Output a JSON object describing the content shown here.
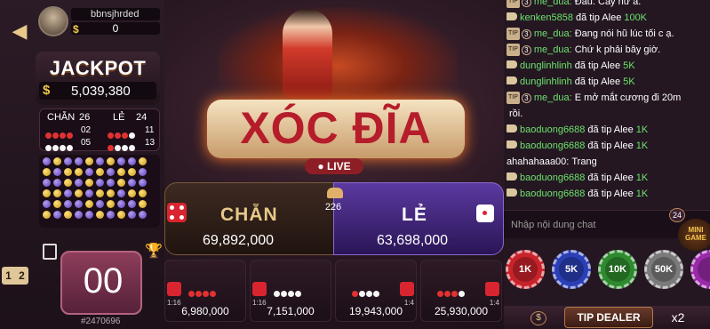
{
  "header": {
    "username": "bbnsjhrded",
    "balance": "0"
  },
  "jackpot": {
    "title": "JACKPOT",
    "currency": "$",
    "value": "5,039,380"
  },
  "stats": {
    "chan_label": "CHẴN",
    "chan_count": "26",
    "le_label": "LẺ",
    "le_count": "24",
    "row1_chan": "02",
    "row1_le": "11",
    "row2_chan": "05",
    "row2_le": "13"
  },
  "pager": {
    "p1": "1",
    "p2": "2"
  },
  "timer": {
    "value": "00",
    "session": "#2470696"
  },
  "game": {
    "logo": "XÓC ĐĨA",
    "live": "● LIVE",
    "players": "226"
  },
  "bets": {
    "chan_label": "CHẴN",
    "chan_amount": "69,892,000",
    "le_label": "LẺ",
    "le_amount": "63,698,000",
    "small": [
      {
        "amount": "6,980,000",
        "ratio": "1:16"
      },
      {
        "amount": "7,151,000",
        "ratio": "1:16"
      },
      {
        "amount": "19,943,000",
        "ratio": "1:4"
      },
      {
        "amount": "25,930,000",
        "ratio": "1:4"
      }
    ]
  },
  "chat": [
    {
      "type": "tip",
      "n": "3",
      "user": "me_dua:",
      "msg": "Đau. Cay nữ a."
    },
    {
      "type": "spk",
      "user": "kenken5858",
      "msg": "đã tip Alee",
      "amount": "100K"
    },
    {
      "type": "tip",
      "n": "3",
      "user": "me_dua:",
      "msg": "Đang nói hũ lúc tối c ạ."
    },
    {
      "type": "tip",
      "n": "3",
      "user": "me_dua:",
      "msg": "Chứ k phải bây giờ."
    },
    {
      "type": "spk",
      "user": "dunglinhlinh",
      "msg": "đã tip Alee",
      "amount": "5K"
    },
    {
      "type": "spk",
      "user": "dunglinhlinh",
      "msg": "đã tip Alee",
      "amount": "5K"
    },
    {
      "type": "tip",
      "n": "3",
      "user": "me_dua:",
      "msg": "E mở mắt cương đi 20m"
    },
    {
      "type": "plain",
      "user": "",
      "msg": "rồi."
    },
    {
      "type": "spk",
      "user": "baoduong6688",
      "msg": "đã tip Alee",
      "amount": "1K"
    },
    {
      "type": "spk",
      "user": "baoduong6688",
      "msg": "đã tip Alee",
      "amount": "1K"
    },
    {
      "type": "plain",
      "user": "ahahahaaa00:",
      "msg": "Trang"
    },
    {
      "type": "spk",
      "user": "baoduong6688",
      "msg": "đã tip Alee",
      "amount": "1K"
    },
    {
      "type": "spk",
      "user": "baoduong6688",
      "msg": "đã tip Alee",
      "amount": "1K"
    }
  ],
  "chat_input": {
    "placeholder": "Nhập nội dung chat"
  },
  "mini": {
    "badge": "24",
    "label": "MINI GAME"
  },
  "chips": [
    {
      "label": "1K",
      "color": "#c8232b"
    },
    {
      "label": "5K",
      "color": "#2a3fb5"
    },
    {
      "label": "10K",
      "color": "#2e8a2e"
    },
    {
      "label": "50K",
      "color": "#7a7a7a"
    },
    {
      "label": "",
      "color": "#9a2aa8"
    }
  ],
  "tipbar": {
    "coin": "$",
    "button": "TIP DEALER",
    "multiplier": "x2"
  }
}
